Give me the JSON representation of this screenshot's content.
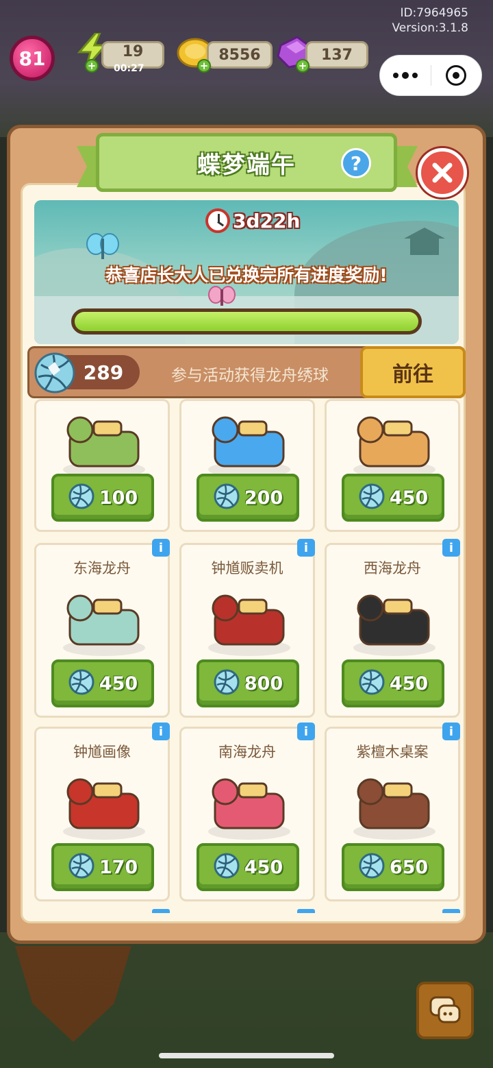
{
  "hud": {
    "id_text": "ID:7964965",
    "version_text": "Version:3.1.8",
    "level": "81",
    "energy": "19",
    "energy_timer": "00:27",
    "coins": "8556",
    "gems": "137"
  },
  "dialog": {
    "title": "蝶梦端午",
    "help_label": "?",
    "timer": "3d22h",
    "congrats_text": "恭喜店长大人已兑换完所有进度奖励!",
    "progress": 1.0,
    "currency_count": "289",
    "currency_hint": "参与活动获得龙舟绣球",
    "goto_label": "前往"
  },
  "shop": {
    "info_label": "i",
    "items": [
      {
        "name": "",
        "price": "100",
        "art": "drum-boat-art",
        "color": "#8fbf5a"
      },
      {
        "name": "",
        "price": "200",
        "art": "water-tile-art",
        "color": "#4aa8ee"
      },
      {
        "name": "",
        "price": "450",
        "art": "golden-dragon-boat-art",
        "color": "#e8a85a"
      },
      {
        "name": "东海龙舟",
        "price": "450",
        "art": "east-sea-dragon-boat-art",
        "color": "#9fd6c8"
      },
      {
        "name": "钟馗贩卖机",
        "price": "800",
        "art": "zhongkui-vending-machine-art",
        "color": "#b8322b"
      },
      {
        "name": "西海龙舟",
        "price": "450",
        "art": "west-sea-dragon-boat-art",
        "color": "#2f2f2f"
      },
      {
        "name": "钟馗画像",
        "price": "170",
        "art": "zhongkui-portrait-art",
        "color": "#c8352b"
      },
      {
        "name": "南海龙舟",
        "price": "450",
        "art": "south-sea-dragon-boat-art",
        "color": "#e55a73"
      },
      {
        "name": "紫檀木桌案",
        "price": "650",
        "art": "rosewood-desk-art",
        "color": "#8b4d36"
      }
    ]
  },
  "colors": {
    "dialog_frame": "#d9a574",
    "title_green": "#b7dc7a",
    "price_green": "#7fb83a",
    "goto_yellow": "#f0c24a",
    "close_red": "#e8554a",
    "info_blue": "#3fa4ee"
  }
}
